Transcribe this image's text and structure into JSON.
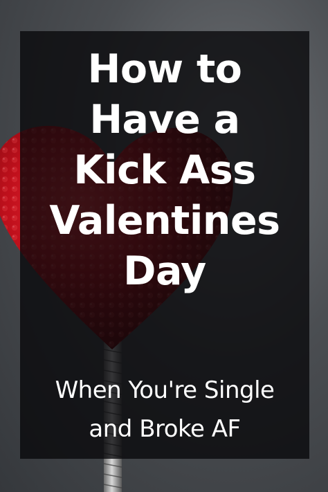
{
  "colors": {
    "background": "#4b4e52",
    "overlay": "#08080a",
    "heart": "#c0101c",
    "text": "#ffffff"
  },
  "title": {
    "lines": [
      "How to",
      "Have a",
      "Kick Ass",
      "Valentines",
      "Day"
    ]
  },
  "subtitle": {
    "lines": [
      "When You're Single",
      "and Broke AF"
    ]
  }
}
